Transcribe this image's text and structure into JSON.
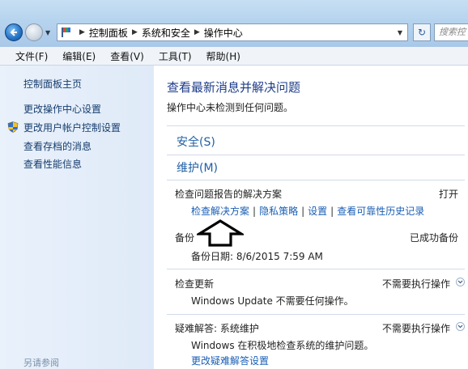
{
  "address_bar": {
    "crumbs": [
      "控制面板",
      "系统和安全",
      "操作中心"
    ]
  },
  "search": {
    "placeholder": "搜索控"
  },
  "menu": {
    "items": [
      "文件(F)",
      "编辑(E)",
      "查看(V)",
      "工具(T)",
      "帮助(H)"
    ]
  },
  "sidebar": {
    "items": [
      {
        "label": "控制面板主页",
        "icon": ""
      },
      {
        "label": "更改操作中心设置",
        "icon": ""
      },
      {
        "label": "更改用户帐户控制设置",
        "icon": "uac-shield-icon"
      },
      {
        "label": "查看存档的消息",
        "icon": ""
      },
      {
        "label": "查看性能信息",
        "icon": ""
      }
    ],
    "footer": "另请参阅"
  },
  "main": {
    "title": "查看最新消息并解决问题",
    "subtitle": "操作中心未检测到任何问题。",
    "security_header": "安全(S)",
    "maintenance_header": "维护(M)",
    "problem_reports": {
      "label": "检查问题报告的解决方案",
      "status": "打开",
      "links": [
        "检查解决方案",
        "隐私策略",
        "设置",
        "查看可靠性历史记录"
      ]
    },
    "backup": {
      "label": "备份",
      "status": "已成功备份",
      "detail": "备份日期: 8/6/2015 7:59 AM"
    },
    "updates": {
      "label": "检查更新",
      "status": "不需要执行操作",
      "detail": "Windows Update 不需要任何操作。"
    },
    "troubleshooting": {
      "label": "疑难解答: 系统维护",
      "status": "不需要执行操作",
      "detail": "Windows 在积极地检查系统的维护问题。",
      "link": "更改疑难解答设置"
    }
  },
  "colors": {
    "link": "#1a5fb4",
    "title": "#1e3d8a",
    "sidebar_bg": "#e3edf9"
  }
}
